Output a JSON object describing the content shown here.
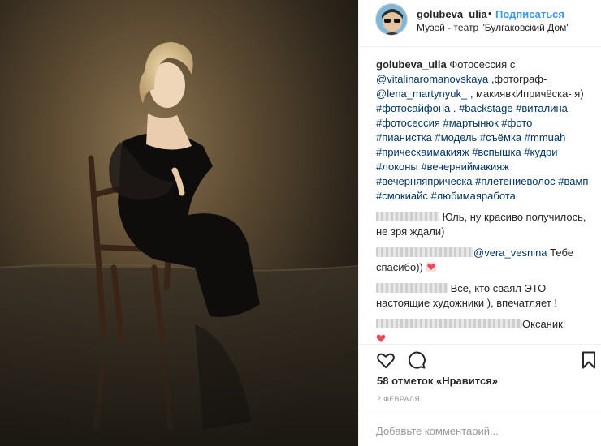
{
  "post": {
    "photo_alt": "Фото женщины в черном платье на стуле в воде",
    "author": {
      "username": "golubeva_ulia",
      "separator": "•",
      "follow_label": "Подписаться",
      "location": "Музей - театр \"Булгаковский Дом\""
    },
    "caption": {
      "username": "golubeva_ulia",
      "text_1": " Фотосессия с ",
      "mention_1": "@vitalinaromanovskaya",
      "text_2": " ,фотограф- ",
      "mention_2": "@lena_martynyuk_",
      "text_3": " , макиявкИпричёска- я) ",
      "hashtags": "#фотосайфона . #backstage #виталина #фотосессия #мартынюк #фото #пианистка #модель #съёмка #mmuah #прическаимакияж #вспышка #кудри #локоны #вечерниймакияж #вечерняяприческа #плетениеволос #вамп #смокиайс #любимаяработа"
    },
    "comments": [
      {
        "text": " Юль, ну красиво получилось, не зря ждали)",
        "mention": "",
        "suffix": "",
        "heart": false
      },
      {
        "text": "",
        "mention": "@vera_vesnina",
        "suffix": " Тебе спасибо))",
        "heart": true
      },
      {
        "text": " Все, кто сваял ЭТО - настоящие художники ), впечатляет !",
        "mention": "",
        "suffix": "",
        "heart": false
      },
      {
        "text": "Оксаник!",
        "mention": "",
        "suffix": "",
        "heart": true
      }
    ],
    "likes_text": "58 отметок «Нравится»",
    "date_text": "2 ФЕВРАЛЯ",
    "add_comment_placeholder": "Добавьте комментарий...",
    "icons": {
      "like": "heart-outline-icon",
      "comment": "comment-bubble-icon",
      "save": "bookmark-icon"
    },
    "colors": {
      "link": "#003569",
      "follow": "#3897f0",
      "heart_emoji": "#ed4956",
      "muted": "#999999"
    }
  }
}
